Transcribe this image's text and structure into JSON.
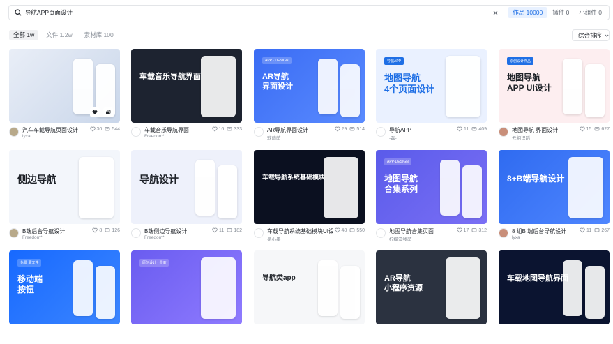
{
  "search": {
    "query": "导航APP页面设计"
  },
  "tabs": [
    {
      "label": "作品",
      "count": "10000"
    },
    {
      "label": "插件",
      "count": "0"
    },
    {
      "label": "小组件",
      "count": "0"
    }
  ],
  "filters": [
    {
      "label": "全部",
      "count": "1w"
    },
    {
      "label": "文件",
      "count": "1.2w"
    },
    {
      "label": "素材库",
      "count": "100"
    }
  ],
  "sort": {
    "label": "综合排序"
  },
  "cards": [
    {
      "title": "汽车车载导航页面设计",
      "author": "lyxa",
      "likes": "30",
      "views": "544",
      "thumb_text": "",
      "tag": ""
    },
    {
      "title": "车载音乐导航界面",
      "author": "Freedom*",
      "likes": "16",
      "views": "333",
      "thumb_text": "车载音乐导航界面",
      "tag": ""
    },
    {
      "title": "AR导航界面设计",
      "author": "软萌萌",
      "likes": "29",
      "views": "514",
      "thumb_text": "AR导航\n界面设计",
      "tag": "APP · DESIGN"
    },
    {
      "title": "导航APP",
      "author": "-磊-",
      "likes": "11",
      "views": "409",
      "thumb_text": "地图导航\n4个页面设计",
      "tag": "导航APP"
    },
    {
      "title": "地图导航 界面设计",
      "author": "云相识蹈",
      "likes": "15",
      "views": "627",
      "thumb_text": "地图导航\nAPP UI设计",
      "tag": "原创设计作品"
    },
    {
      "title": "B端后台导航设计",
      "author": "Freedom*",
      "likes": "8",
      "views": "126",
      "thumb_text": "侧边导航",
      "tag": ""
    },
    {
      "title": "B端侧边导航设计",
      "author": "Freedom*",
      "likes": "11",
      "views": "182",
      "thumb_text": "导航设计",
      "tag": ""
    },
    {
      "title": "车载导航系统基础模块UI设计",
      "author": "吴小墨",
      "likes": "48",
      "views": "550",
      "thumb_text": "车载导航系统基础模块",
      "tag": ""
    },
    {
      "title": "地图导航合集页面",
      "author": "柠檬没我萌",
      "likes": "17",
      "views": "312",
      "thumb_text": "地图导航\n合集系列",
      "tag": "APP·DESIGN"
    },
    {
      "title": "8 组B 端后台导航设计",
      "author": "lyxa",
      "likes": "11",
      "views": "267",
      "thumb_text": "8+B端导航设计",
      "tag": ""
    },
    {
      "title": "",
      "author": "",
      "likes": "",
      "views": "",
      "thumb_text": "移动端\n按钮",
      "tag": "免费 源文件"
    },
    {
      "title": "",
      "author": "",
      "likes": "",
      "views": "",
      "thumb_text": "",
      "tag": "原创设计 · 界面"
    },
    {
      "title": "",
      "author": "",
      "likes": "",
      "views": "",
      "thumb_text": "导航类app",
      "tag": ""
    },
    {
      "title": "",
      "author": "",
      "likes": "",
      "views": "",
      "thumb_text": "AR导航\n小程序资源",
      "tag": ""
    },
    {
      "title": "",
      "author": "",
      "likes": "",
      "views": "",
      "thumb_text": "车载地图导航界面",
      "tag": ""
    }
  ],
  "colors": {
    "accent": "#1f6fe5",
    "muted": "#8a9099"
  }
}
